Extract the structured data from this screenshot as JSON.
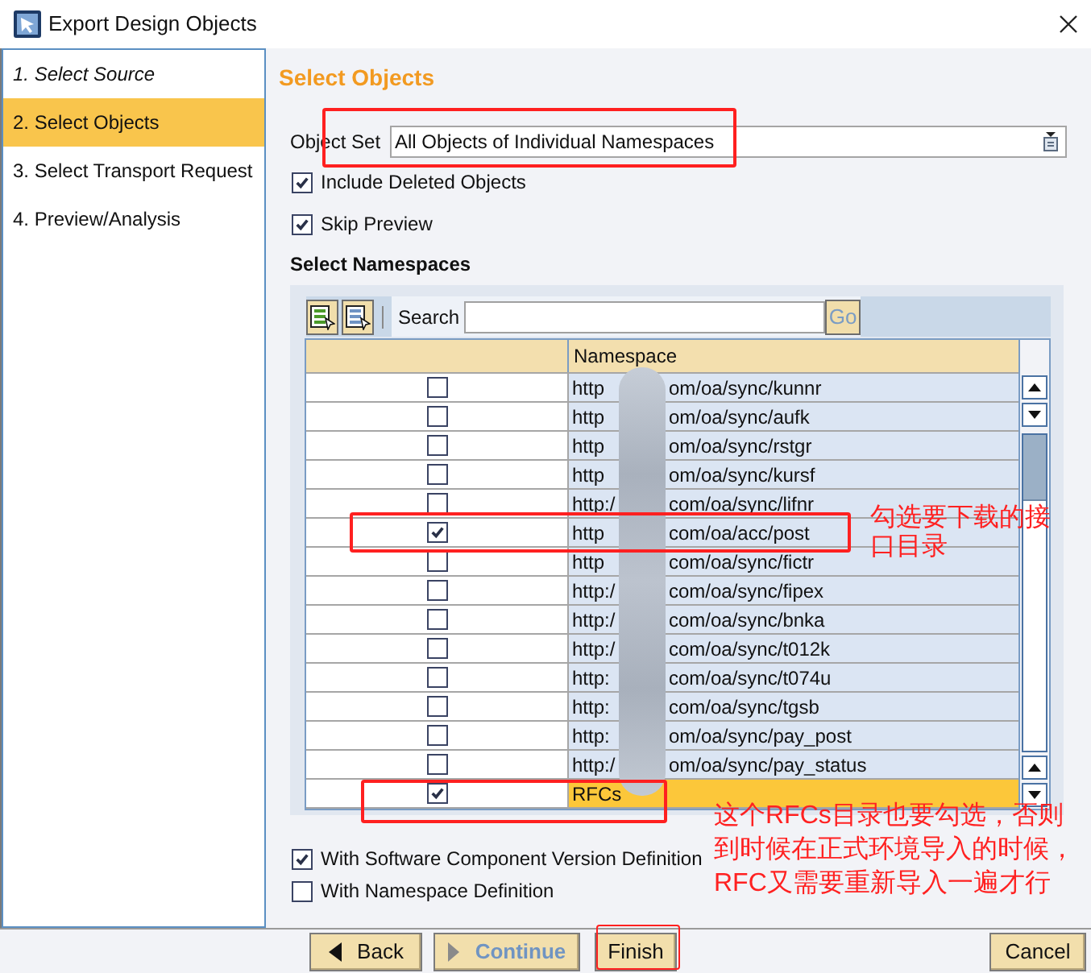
{
  "window": {
    "title": "Export Design Objects"
  },
  "steps": [
    {
      "label": "1. Select Source",
      "selected": false,
      "completed": true
    },
    {
      "label": "2. Select Objects",
      "selected": true,
      "completed": false
    },
    {
      "label": "3. Select Transport Request",
      "selected": false,
      "completed": false
    },
    {
      "label": "4. Preview/Analysis",
      "selected": false,
      "completed": false
    }
  ],
  "page_title": "Select Objects",
  "object_set": {
    "label": "Object Set",
    "value": "All Objects of Individual Namespaces"
  },
  "options": [
    {
      "label": "Include Deleted Objects",
      "checked": true
    },
    {
      "label": "Skip Preview",
      "checked": true
    }
  ],
  "namespaces": {
    "title": "Select Namespaces",
    "search_label": "Search",
    "go_button": "Go",
    "column_header": "Namespace",
    "rows": [
      {
        "checked": false,
        "selected": false,
        "parts": [
          "http",
          "om/oa/sync/kunnr"
        ]
      },
      {
        "checked": false,
        "selected": false,
        "parts": [
          "http",
          "om/oa/sync/aufk"
        ]
      },
      {
        "checked": false,
        "selected": false,
        "parts": [
          "http",
          "om/oa/sync/rstgr"
        ]
      },
      {
        "checked": false,
        "selected": false,
        "parts": [
          "http",
          "om/oa/sync/kursf"
        ]
      },
      {
        "checked": false,
        "selected": false,
        "parts": [
          "http:/",
          "com/oa/sync/lifnr"
        ]
      },
      {
        "checked": true,
        "selected": false,
        "parts": [
          "http",
          "com/oa/acc/post"
        ]
      },
      {
        "checked": false,
        "selected": false,
        "parts": [
          "http",
          "com/oa/sync/fictr"
        ]
      },
      {
        "checked": false,
        "selected": false,
        "parts": [
          "http:/",
          "com/oa/sync/fipex"
        ]
      },
      {
        "checked": false,
        "selected": false,
        "parts": [
          "http:/",
          "com/oa/sync/bnka"
        ]
      },
      {
        "checked": false,
        "selected": false,
        "parts": [
          "http:/",
          "com/oa/sync/t012k"
        ]
      },
      {
        "checked": false,
        "selected": false,
        "parts": [
          "http:",
          "com/oa/sync/t074u"
        ]
      },
      {
        "checked": false,
        "selected": false,
        "parts": [
          "http:",
          "com/oa/sync/tgsb"
        ]
      },
      {
        "checked": false,
        "selected": false,
        "parts": [
          "http:",
          "om/oa/sync/pay_post"
        ]
      },
      {
        "checked": false,
        "selected": false,
        "parts": [
          "http:/",
          "om/oa/sync/pay_status"
        ]
      },
      {
        "checked": true,
        "selected": true,
        "parts": [
          "RFCs"
        ]
      }
    ]
  },
  "definition_options": [
    {
      "label": "With Software Component Version Definition",
      "checked": true
    },
    {
      "label": "With Namespace Definition",
      "checked": false
    }
  ],
  "buttons": [
    {
      "label": "Back",
      "kind": "back",
      "disabled": false
    },
    {
      "label": "Continue",
      "kind": "next",
      "disabled": true
    },
    {
      "label": "Finish",
      "kind": "finish",
      "disabled": false
    },
    {
      "label": "Cancel",
      "kind": "cancel",
      "disabled": false
    }
  ],
  "annotations": [
    {
      "text": "勾选要下载的接口目录"
    },
    {
      "text": "这个RFCs目录也要勾选，否则到时候在正式环境导入的时候，RFC又需要重新导入一遍才行"
    }
  ]
}
